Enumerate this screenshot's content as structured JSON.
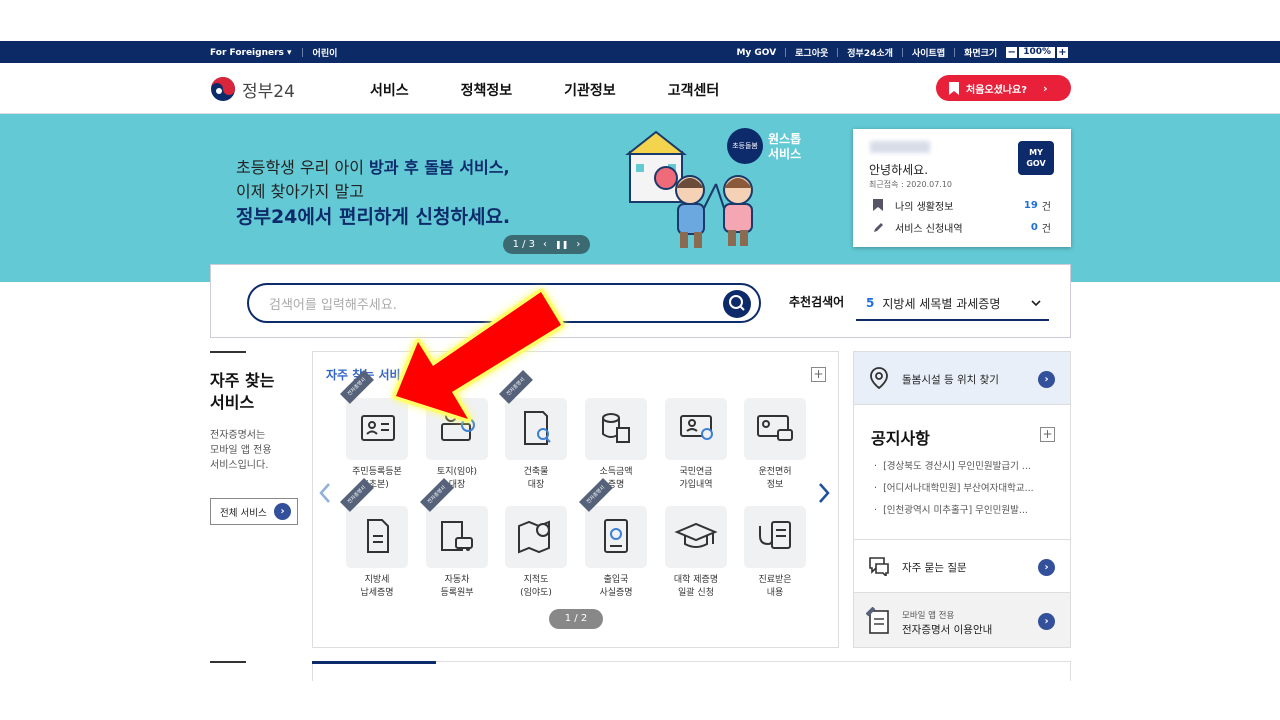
{
  "util": {
    "for_foreigners": "For Foreigners ▾",
    "kids": "어린이",
    "mygov": "My GOV",
    "logout": "로그아웃",
    "intro": "정부24소개",
    "sitemap": "사이트맵",
    "screen_size": "화면크기",
    "zoom": "100%"
  },
  "header": {
    "logo": "정부24",
    "nav": [
      "서비스",
      "정책정보",
      "기관정보",
      "고객센터"
    ],
    "first_visit": "처음오셨나요?"
  },
  "banner": {
    "line1_a": "초등학생 우리 아이 ",
    "line1_b": "방과 후 돌봄 서비스,",
    "line2": "이제 찾아가지 말고",
    "line3": "정부24에서 편리하게 신청하세요.",
    "pager": "1 / 3",
    "badge_small": "초등돌봄",
    "badge_line1": "원스톱",
    "badge_line2": "서비스"
  },
  "mygov_card": {
    "greeting": "안녕하세요.",
    "last_access": "최근접속 : 2020.07.10",
    "badge_line1": "MY",
    "badge_line2": "GOV",
    "rows": [
      {
        "label": "나의 생활정보",
        "count": "19",
        "unit": "건"
      },
      {
        "label": "서비스 신청내역",
        "count": "0",
        "unit": "건"
      }
    ]
  },
  "search": {
    "placeholder": "검색어를 입력해주세요.",
    "rec_label": "추천검색어",
    "rec_num": "5",
    "rec_term": "지방세 세목별 과세증명"
  },
  "left": {
    "title_line1": "자주 찾는",
    "title_line2": "서비스",
    "desc_line1": "전자증명서는",
    "desc_line2": "모바일 앱 전용",
    "desc_line3": "서비스입니다.",
    "all_btn": "전체 서비스"
  },
  "services": {
    "head_a": "자주 찾는 서비",
    "head_b": "니다.",
    "ribbon": "전자증명서",
    "pager": "1 / 2",
    "items": [
      {
        "l1": "주민등록등본",
        "l2": "(초본)"
      },
      {
        "l1": "토지(임야)",
        "l2": "대장"
      },
      {
        "l1": "건축물",
        "l2": "대장"
      },
      {
        "l1": "소득금액",
        "l2": "증명"
      },
      {
        "l1": "국민연금",
        "l2": "가입내역"
      },
      {
        "l1": "운전면허",
        "l2": "정보"
      },
      {
        "l1": "지방세",
        "l2": "납세증명"
      },
      {
        "l1": "자동차",
        "l2": "등록원부"
      },
      {
        "l1": "지적도",
        "l2": "(임야도)"
      },
      {
        "l1": "출입국",
        "l2": "사실증명"
      },
      {
        "l1": "대학 제증명",
        "l2": "일괄 신청"
      },
      {
        "l1": "진료받은",
        "l2": "내용"
      }
    ]
  },
  "right": {
    "care": "돌봄시설 등 위치 찾기",
    "notice_title": "공지사항",
    "notices": [
      "[경상북도 경산시] 무인민원발급기 ...",
      "[어디서나대학민원] 부산여자대학교...",
      "[인천광역시 미추홀구] 무인민원발..."
    ],
    "faq": "자주 묻는 질문",
    "mobile_small": "모바일 앱 전용",
    "mobile_main": "전자증명서 이용안내"
  }
}
